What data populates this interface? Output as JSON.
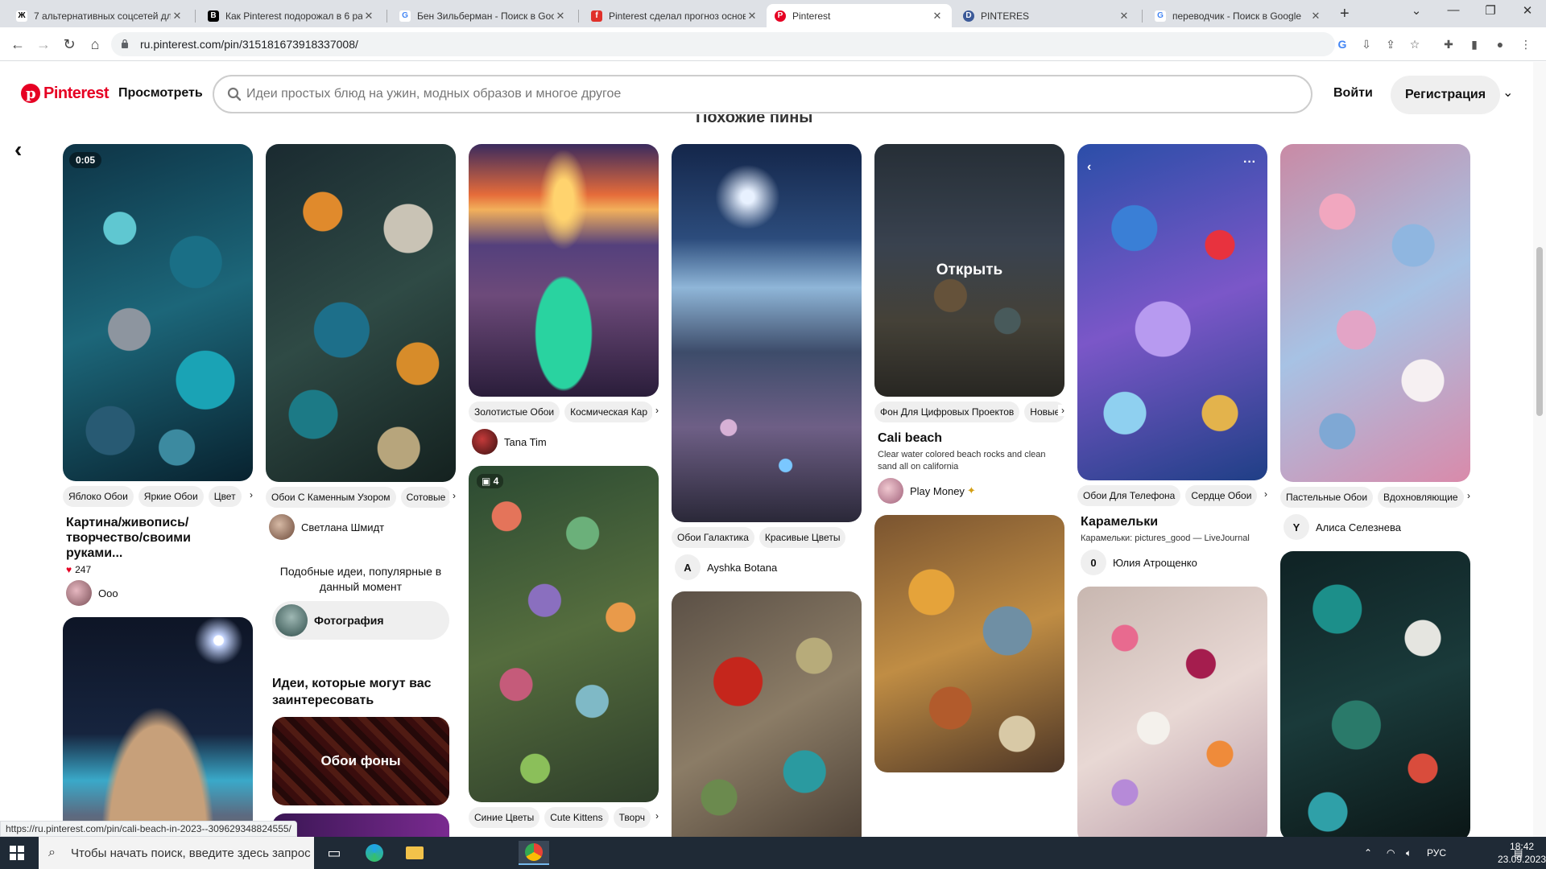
{
  "browser": {
    "tabs": [
      {
        "label": "7 альтернативных соцсетей для",
        "favicon": "Ж",
        "fav_color": "#000000",
        "fav_bg": "#ffffff",
        "active": false
      },
      {
        "label": "Как Pinterest подорожал в 6 ра",
        "favicon": "B",
        "fav_color": "#ffffff",
        "fav_bg": "#000000",
        "active": false
      },
      {
        "label": "Бен Зильберман - Поиск в Goo",
        "favicon": "G",
        "fav_color": "#4285f4",
        "fav_bg": "#ffffff",
        "active": false
      },
      {
        "label": "Pinterest сделал прогноз основ",
        "favicon": "f",
        "fav_color": "#ffffff",
        "fav_bg": "#e0302a",
        "active": false
      },
      {
        "label": "Pinterest",
        "favicon": "P",
        "fav_color": "#ffffff",
        "fav_bg": "#e60023",
        "active": true
      },
      {
        "label": "PINTERES",
        "favicon": "D",
        "fav_color": "#ffffff",
        "fav_bg": "#3b5998",
        "active": false
      },
      {
        "label": "переводчик - Поиск в Google",
        "favicon": "G",
        "fav_color": "#4285f4",
        "fav_bg": "#ffffff",
        "active": false
      }
    ],
    "url": "ru.pinterest.com/pin/315181673918337008/"
  },
  "header": {
    "logo": "Pinterest",
    "browse": "Просмотреть",
    "search_placeholder": "Идеи простых блюд на ужин, модных образов и многое другое",
    "login": "Войти",
    "signup": "Регистрация"
  },
  "section_title": "Похожие пины",
  "columns": [
    {
      "pins": [
        {
          "duration": "0:05",
          "chips": [
            "Яблоко Обои",
            "Яркие Обои",
            "Цвет"
          ],
          "title": "Картина/живопись/творчество/своими руками...",
          "likes": "247",
          "author": "Ooo",
          "author_initial": ""
        },
        {
          "chips": [],
          "title": "",
          "author": ""
        }
      ]
    },
    {
      "pins": [
        {
          "chips": [
            "Обои С Каменным Узором",
            "Сотовые"
          ],
          "author": "Светлана Шмидт"
        }
      ],
      "ideas_heading": "Подобные идеи, популярные в данный момент",
      "ideas_pill": "Фотография",
      "ideas2_heading": "Идеи, которые могут вас заинтересовать",
      "board": "Обои фоны"
    },
    {
      "pins": [
        {
          "chips": [
            "Золотистые Обои",
            "Космическая Кар"
          ],
          "author": "Tana Tim"
        },
        {
          "count": "4",
          "chips": [
            "Синие Цветы",
            "Cute Kittens",
            "Творч"
          ]
        }
      ]
    },
    {
      "pins": [
        {
          "chips": [
            "Обои Галактика",
            "Красивые Цветы"
          ],
          "author": "Ayshka Botana",
          "author_initial": "A"
        },
        {
          "chips": []
        }
      ]
    },
    {
      "pins": [
        {
          "overlay": "Открыть",
          "chips": [
            "Фон Для Цифровых Проектов",
            "Новые"
          ],
          "title": "Cali beach",
          "desc": "Clear water colored beach rocks and clean sand all on california",
          "author": "Play Money"
        },
        {
          "chips": []
        }
      ]
    },
    {
      "pins": [
        {
          "chips": [
            "Обои Для Телефона",
            "Сердце Обои"
          ],
          "title": "Карамельки",
          "desc": "Карамельки: pictures_good — LiveJournal",
          "author": "Юлия Атрощенко",
          "author_initial": "0"
        },
        {
          "chips": []
        }
      ]
    },
    {
      "pins": [
        {
          "chips": [
            "Пастельные Обои",
            "Вдохновляющие"
          ],
          "author": "Алиса Селезнева",
          "author_initial": "Y"
        },
        {
          "chips": []
        }
      ]
    }
  ],
  "status_url": "https://ru.pinterest.com/pin/cali-beach-in-2023--309629348824555/",
  "taskbar": {
    "search_placeholder": "Чтобы начать поиск, введите здесь запрос",
    "lang": "РУС",
    "time": "18:42",
    "date": "23.09.2023"
  }
}
